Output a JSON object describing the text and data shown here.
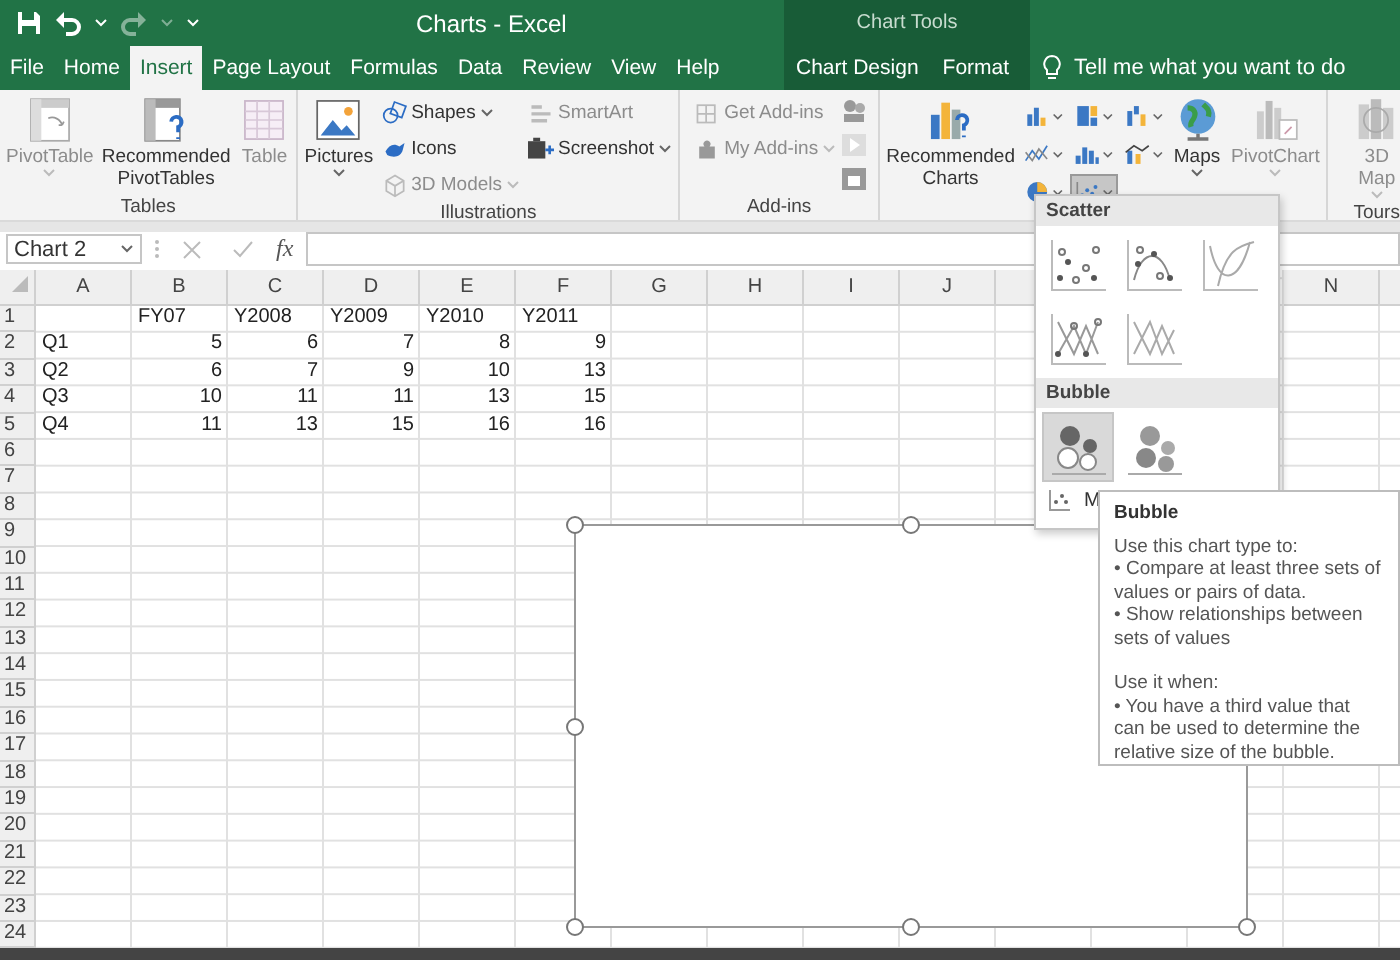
{
  "window": {
    "title": "Charts  -  Excel"
  },
  "contextual_group": {
    "label": "Chart Tools"
  },
  "tabs": [
    {
      "label": "File",
      "selected": false,
      "contextual": false
    },
    {
      "label": "Home",
      "selected": false,
      "contextual": false
    },
    {
      "label": "Insert",
      "selected": true,
      "contextual": false
    },
    {
      "label": "Page Layout",
      "selected": false,
      "contextual": false
    },
    {
      "label": "Formulas",
      "selected": false,
      "contextual": false
    },
    {
      "label": "Data",
      "selected": false,
      "contextual": false
    },
    {
      "label": "Review",
      "selected": false,
      "contextual": false
    },
    {
      "label": "View",
      "selected": false,
      "contextual": false
    },
    {
      "label": "Help",
      "selected": false,
      "contextual": false
    },
    {
      "label": "Chart Design",
      "selected": false,
      "contextual": true
    },
    {
      "label": "Format",
      "selected": false,
      "contextual": true
    }
  ],
  "tell_me": {
    "placeholder": "Tell me what you want to do"
  },
  "ribbon": {
    "groups": [
      {
        "label": "Tables",
        "items": [
          {
            "kind": "large",
            "label": "PivotTable",
            "disabled": true,
            "dropdown": true
          },
          {
            "kind": "large",
            "label": "Recommended PivotTables",
            "disabled": false,
            "dropdown": false
          },
          {
            "kind": "large",
            "label": "Table",
            "disabled": true,
            "dropdown": false
          }
        ]
      },
      {
        "label": "Illustrations",
        "items": [
          {
            "kind": "large",
            "label": "Pictures",
            "disabled": false,
            "dropdown": true
          },
          {
            "kind": "stack",
            "items": [
              {
                "label": "Shapes",
                "disabled": false,
                "dropdown": true
              },
              {
                "label": "Icons",
                "disabled": false,
                "dropdown": false
              },
              {
                "label": "3D Models",
                "disabled": true,
                "dropdown": true
              }
            ]
          },
          {
            "kind": "stack",
            "items": [
              {
                "label": "SmartArt",
                "disabled": true,
                "dropdown": false
              },
              {
                "label": "Screenshot",
                "disabled": false,
                "dropdown": true
              }
            ]
          }
        ]
      },
      {
        "label": "Add-ins",
        "items": [
          {
            "kind": "stack",
            "items": [
              {
                "label": "Get Add-ins",
                "disabled": true,
                "dropdown": false
              },
              {
                "label": "My Add-ins",
                "disabled": true,
                "dropdown": true
              }
            ]
          },
          {
            "kind": "iconcolumn"
          }
        ]
      },
      {
        "items": [
          {
            "kind": "large",
            "label": "Recommended Charts",
            "disabled": false,
            "dropdown": false
          },
          {
            "kind": "chartgrid",
            "buttons": [
              {
                "selected": false
              },
              {
                "selected": false
              },
              {
                "selected": false
              },
              {
                "selected": false
              },
              {
                "selected": false
              },
              {
                "selected": false
              },
              {
                "selected": false
              },
              {
                "selected": true
              }
            ]
          },
          {
            "kind": "large",
            "label": "Maps",
            "disabled": false,
            "dropdown": true
          },
          {
            "kind": "large",
            "label": "PivotChart",
            "disabled": true,
            "dropdown": true
          }
        ]
      },
      {
        "label": "Tours",
        "items": [
          {
            "kind": "large",
            "label": "3D Map",
            "disabled": true,
            "dropdown": true
          }
        ]
      }
    ]
  },
  "formula_bar": {
    "name_box": "Chart 2",
    "function_label": "fx"
  },
  "sheet": {
    "columns": [
      "A",
      "B",
      "C",
      "D",
      "E",
      "F",
      "G",
      "H",
      "I",
      "J",
      "N"
    ],
    "rows": [
      {
        "header": "1",
        "headings": [
          "FY07",
          "Y2008",
          "Y2009",
          "Y2010",
          "Y2011"
        ]
      },
      {
        "header": "2",
        "label": "Q1",
        "values": [
          "5",
          "6",
          "7",
          "8",
          "9"
        ]
      },
      {
        "header": "3",
        "label": "Q2",
        "values": [
          "6",
          "7",
          "9",
          "10",
          "13"
        ]
      },
      {
        "header": "4",
        "label": "Q3",
        "values": [
          "10",
          "11",
          "11",
          "13",
          "15"
        ]
      },
      {
        "header": "5",
        "label": "Q4",
        "values": [
          "11",
          "13",
          "15",
          "16",
          "16"
        ]
      },
      {
        "header": "6"
      },
      {
        "header": "7"
      },
      {
        "header": "8"
      },
      {
        "header": "9"
      },
      {
        "header": "10"
      },
      {
        "header": "11"
      },
      {
        "header": "12"
      },
      {
        "header": "13"
      },
      {
        "header": "14"
      },
      {
        "header": "15"
      },
      {
        "header": "16"
      },
      {
        "header": "17"
      },
      {
        "header": "18"
      },
      {
        "header": "19"
      },
      {
        "header": "20"
      },
      {
        "header": "21"
      },
      {
        "header": "22"
      },
      {
        "header": "23"
      },
      {
        "header": "24"
      }
    ]
  },
  "chart_object": {
    "selected": true
  },
  "chart_menu": {
    "sections": [
      {
        "title": "Scatter",
        "options": [
          {
            "selected": false
          },
          {
            "selected": false
          },
          {
            "selected": false
          },
          {
            "selected": false
          },
          {
            "selected": false
          }
        ]
      },
      {
        "title": "Bubble",
        "options": [
          {
            "selected": true
          },
          {
            "selected": false
          }
        ]
      }
    ],
    "more_label": "M"
  },
  "tooltip": {
    "title": "Bubble",
    "paragraphs": [
      [
        "Use this chart type to:",
        "• Compare at least three sets of values or pairs of data.",
        "• Show relationships between sets of values"
      ],
      [
        "Use it when:",
        "• You have a third value that can be used to determine the relative size of the bubble."
      ]
    ]
  }
}
